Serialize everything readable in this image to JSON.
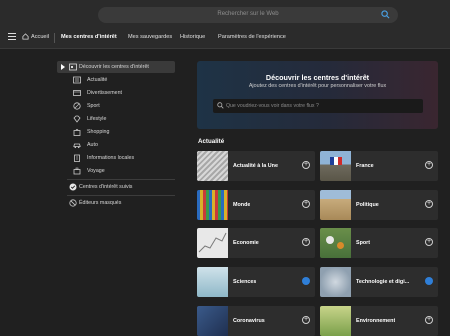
{
  "search": {
    "placeholder": "Rechercher sur le Web"
  },
  "nav": {
    "home": "Accueil",
    "tabs": [
      "Mes centres d'intérêt",
      "Mes sauvegardes",
      "Historique",
      "Paramètres de l'expérience"
    ]
  },
  "sidebar": {
    "discover": "Découvrir les centres d'intérêt",
    "categories": [
      "Actualité",
      "Divertissement",
      "Sport",
      "Lifestyle",
      "Shopping",
      "Auto",
      "Informations locales",
      "Voyage"
    ],
    "followed": "Centres d'intérêt suivis",
    "hidden": "Éditeurs masqués"
  },
  "banner": {
    "title": "Découvrir les centres d'intérêt",
    "subtitle": "Ajoutez des centres d'intérêt pour personnaliser votre flux",
    "search_placeholder": "Que voudriez-vous voir dans votre flux ?"
  },
  "section": {
    "title": "Actualité"
  },
  "cards": [
    {
      "label": "Actualité à la Une",
      "followed": false
    },
    {
      "label": "France",
      "followed": false
    },
    {
      "label": "Monde",
      "followed": false
    },
    {
      "label": "Politique",
      "followed": false
    },
    {
      "label": "Économie",
      "followed": false
    },
    {
      "label": "Sport",
      "followed": false
    },
    {
      "label": "Sciences",
      "followed": true
    },
    {
      "label": "Technologie et digi...",
      "followed": true
    },
    {
      "label": "Coronavirus",
      "followed": false
    },
    {
      "label": "Environnement",
      "followed": false
    }
  ],
  "colors": {
    "accent": "#2f7fd8",
    "background": "#202020",
    "card": "#2d2d2d"
  }
}
